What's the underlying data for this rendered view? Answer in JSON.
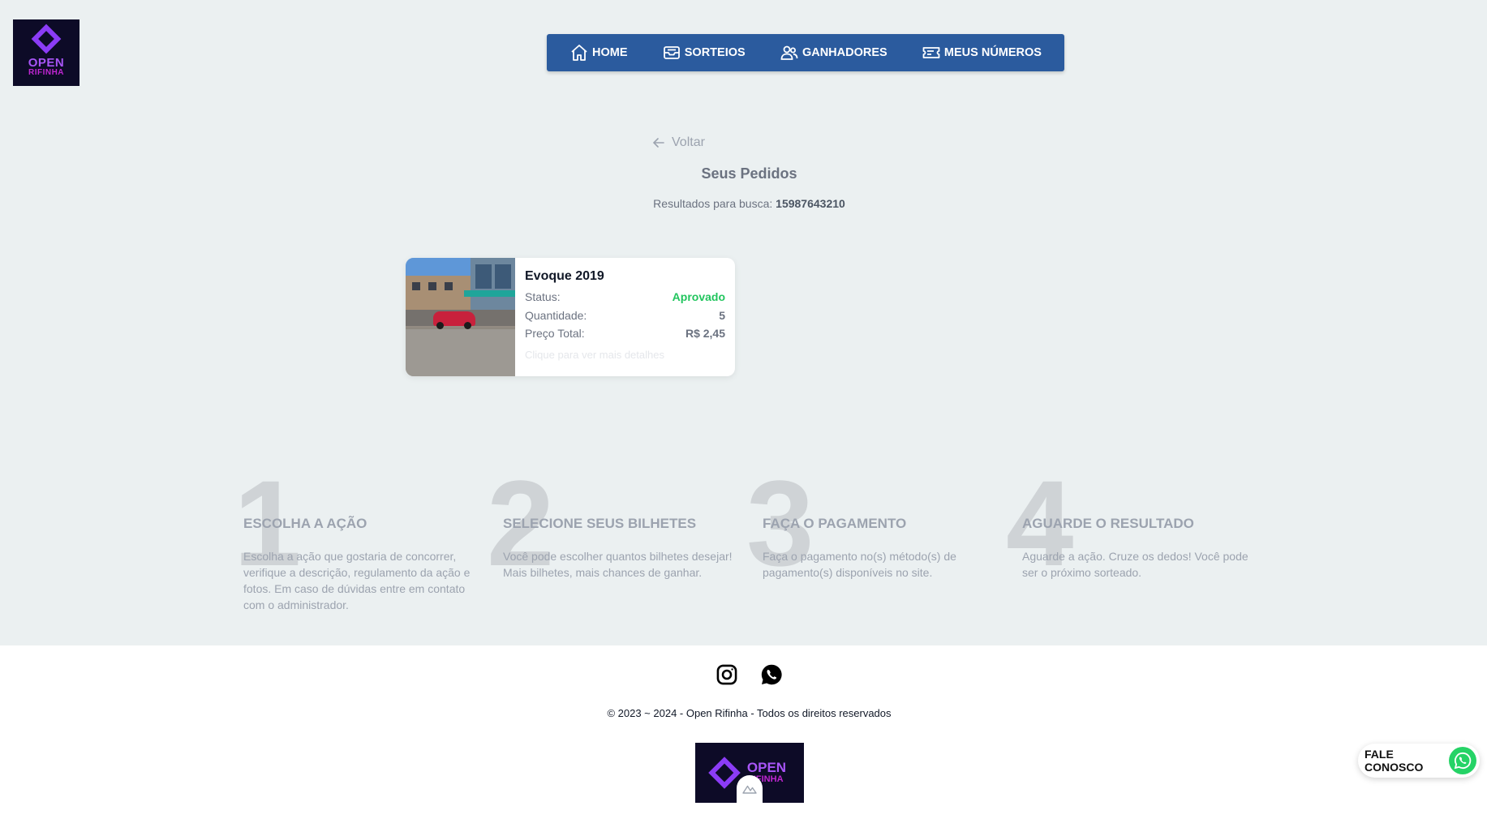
{
  "logo": {
    "line1": "OPEN",
    "line2": "RIFINHA"
  },
  "nav": {
    "items": [
      {
        "label": "HOME",
        "icon": "home-icon"
      },
      {
        "label": "SORTEIOS",
        "icon": "inbox-icon"
      },
      {
        "label": "GANHADORES",
        "icon": "users-icon"
      },
      {
        "label": "MEUS NÚMEROS",
        "icon": "ticket-icon"
      }
    ]
  },
  "back_label": "Voltar",
  "page_title": "Seus Pedidos",
  "search": {
    "prefix": "Resultados para busca:",
    "query": "15987643210"
  },
  "order": {
    "title": "Evoque 2019",
    "status_label": "Status:",
    "status_value": "Aprovado",
    "quantity_label": "Quantidade:",
    "quantity_value": "5",
    "total_label": "Preço Total:",
    "total_value": "R$ 2,45",
    "hint": "Clique para ver mais detalhes",
    "status_color": "#22c55e"
  },
  "steps": [
    {
      "num": "1",
      "title": "ESCOLHA A AÇÃO",
      "text": "Escolha a ação que gostaria de concorrer, verifique a descrição, regulamento da ação e fotos. Em caso de dúvidas entre em contato com o administrador."
    },
    {
      "num": "2",
      "title": "SELECIONE SEUS BILHETES",
      "text": "Você pode escolher quantos bilhetes desejar! Mais bilhetes, mais chances de ganhar."
    },
    {
      "num": "3",
      "title": "FAÇA O PAGAMENTO",
      "text": "Faça o pagamento no(s) método(s) de pagamento(s) disponíveis no site."
    },
    {
      "num": "4",
      "title": "AGUARDE O RESULTADO",
      "text": "Aguarde a ação. Cruze os dedos! Você pode ser o próximo sorteado."
    }
  ],
  "footer": {
    "copyright": "© 2023 ~ 2024 - Open Rifinha - Todos os direitos reservados",
    "logo_line1": "OPEN",
    "logo_line2": "RIFINHA"
  },
  "contact_label": "FALE CONOSCO",
  "colors": {
    "nav_bg": "#2b5b9e",
    "page_bg": "#ebf0f1",
    "whatsapp": "#25d366"
  }
}
